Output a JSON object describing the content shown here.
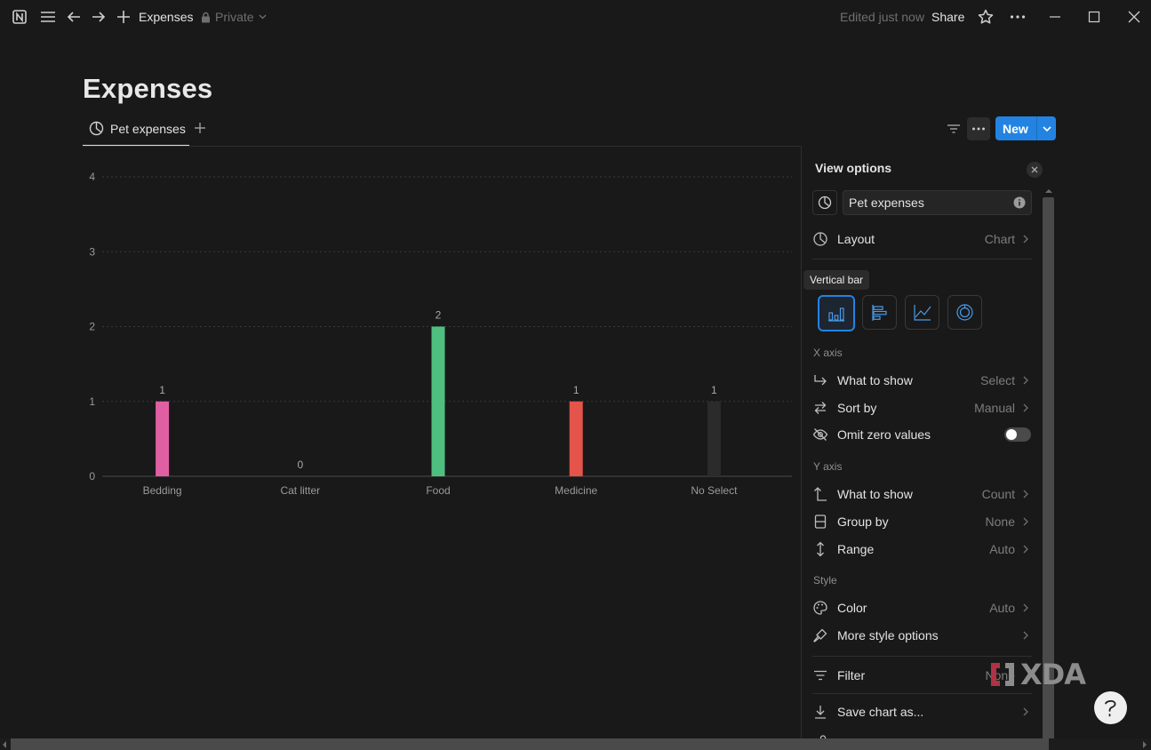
{
  "topbar": {
    "title": "Expenses",
    "privacy": "Private",
    "edited": "Edited just now",
    "share": "Share"
  },
  "page": {
    "title": "Expenses",
    "view_name": "Pet expenses",
    "new_label": "New"
  },
  "chart_data": {
    "type": "bar",
    "categories": [
      "Bedding",
      "Cat litter",
      "Food",
      "Medicine",
      "No Select"
    ],
    "values": [
      1,
      0,
      2,
      1,
      1
    ],
    "data_labels": [
      "1",
      "0",
      "2",
      "1",
      "1"
    ],
    "colors": [
      "#e05fa3",
      "#e05fa3",
      "#4fbf7f",
      "#e5544b",
      "#2b2b2b"
    ],
    "yticks": [
      "0",
      "1",
      "2",
      "3",
      "4"
    ],
    "ylim": [
      0,
      4
    ],
    "grid": true,
    "title": "",
    "xlabel": "",
    "ylabel": ""
  },
  "panel": {
    "title": "View options",
    "view_name_value": "Pet expenses",
    "layout": {
      "label": "Layout",
      "value": "Chart"
    },
    "tooltip": "Vertical bar",
    "x_axis": {
      "title": "X axis",
      "what_to_show": {
        "label": "What to show",
        "value": "Select"
      },
      "sort_by": {
        "label": "Sort by",
        "value": "Manual"
      },
      "omit_zero": {
        "label": "Omit zero values",
        "on": false
      }
    },
    "y_axis": {
      "title": "Y axis",
      "what_to_show": {
        "label": "What to show",
        "value": "Count"
      },
      "group_by": {
        "label": "Group by",
        "value": "None"
      },
      "range": {
        "label": "Range",
        "value": "Auto"
      }
    },
    "style": {
      "title": "Style",
      "color": {
        "label": "Color",
        "value": "Auto"
      },
      "more": {
        "label": "More style options"
      }
    },
    "filter": {
      "label": "Filter",
      "value": "None"
    },
    "save_chart": {
      "label": "Save chart as..."
    }
  },
  "watermark": "XDA"
}
